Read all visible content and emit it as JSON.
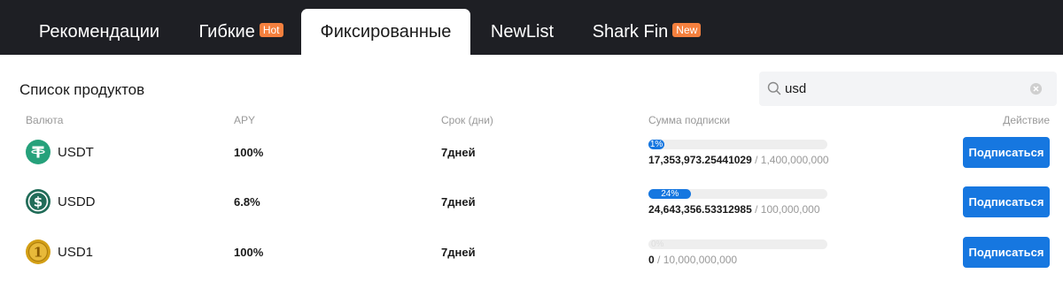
{
  "tabs": [
    {
      "label": "Рекомендации",
      "badge": ""
    },
    {
      "label": "Гибкие",
      "badge": "Hot"
    },
    {
      "label": "Фиксированные",
      "badge": ""
    },
    {
      "label": "NewList",
      "badge": ""
    },
    {
      "label": "Shark Fin",
      "badge": "New"
    }
  ],
  "active_tab": "Фиксированные",
  "section_title": "Список продуктов",
  "search": {
    "value": "usd",
    "placeholder": ""
  },
  "table": {
    "headers": {
      "currency": "Валюта",
      "apy": "APY",
      "term": "Срок (дни)",
      "subscribed": "Сумма подписки",
      "action": "Действие"
    },
    "rows": [
      {
        "coin": "USDT",
        "icon": "tether-icon",
        "icon_color": "#26a17b",
        "apy": "100%",
        "term": "7дней",
        "progress_label": "1%",
        "progress": 0.01,
        "amount": "17,353,973.25441029",
        "total": " / 1,400,000,000",
        "action": "Подписаться"
      },
      {
        "coin": "USDD",
        "icon": "usdd-icon",
        "icon_color": "#216c58",
        "apy": "6.8%",
        "term": "7дней",
        "progress_label": "24%",
        "progress": 0.24,
        "amount": "24,643,356.53312985",
        "total": " / 100,000,000",
        "action": "Подписаться"
      },
      {
        "coin": "USD1",
        "icon": "usd1-icon",
        "icon_color": "#d4a017",
        "apy": "100%",
        "term": "7дней",
        "progress_label": "0%",
        "progress": 0,
        "amount": "0",
        "total": " / 10,000,000,000",
        "action": "Подписаться"
      }
    ]
  },
  "colors": {
    "accent": "#1677e0",
    "badge": "#f5803e",
    "tabbar_bg": "#1e1f24"
  }
}
